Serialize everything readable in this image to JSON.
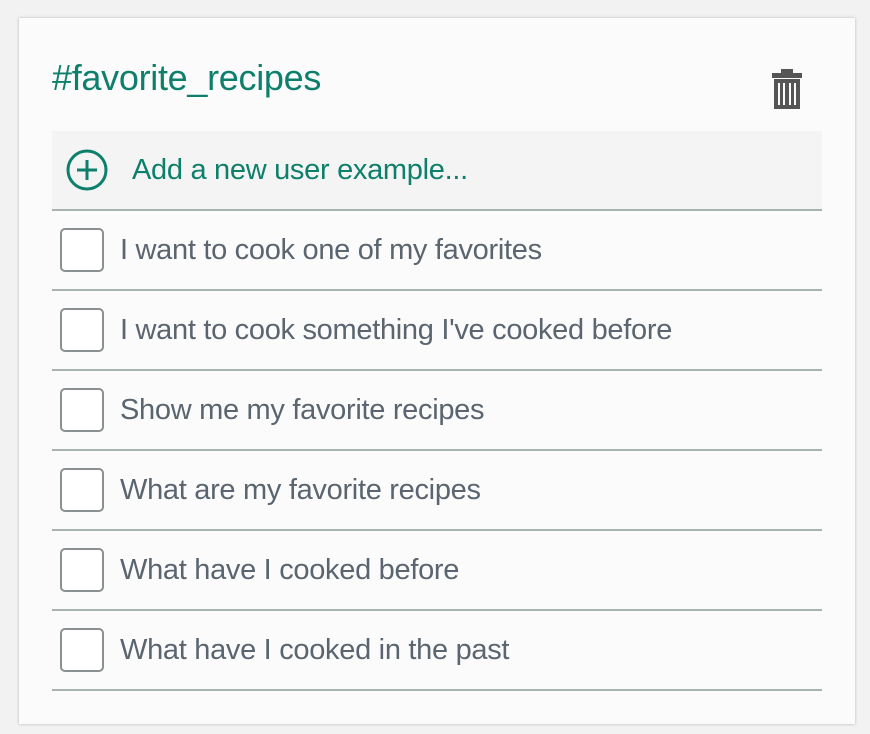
{
  "intent": {
    "title": "#favorite_recipes",
    "delete_icon": "trash-icon"
  },
  "add_example": {
    "label": "Add a new user example...",
    "icon": "plus-circle-icon"
  },
  "examples": [
    {
      "text": "I want to cook one of my favorites",
      "checked": false
    },
    {
      "text": "I want to cook something I've cooked before",
      "checked": false
    },
    {
      "text": "Show me my favorite recipes",
      "checked": false
    },
    {
      "text": "What are my favorite recipes",
      "checked": false
    },
    {
      "text": "What have I cooked before",
      "checked": false
    },
    {
      "text": "What have I cooked in the past",
      "checked": false
    }
  ],
  "colors": {
    "accent": "#0d7f6b",
    "text": "#5a6570",
    "divider": "#a7b3b1",
    "icon": "#555555"
  }
}
